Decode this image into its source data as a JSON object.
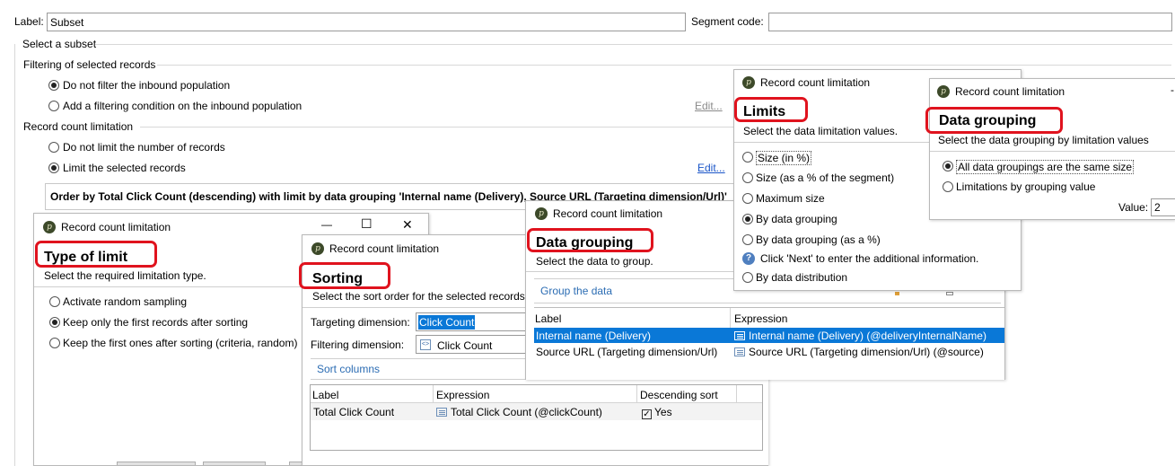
{
  "form": {
    "label_caption": "Label:",
    "label_value": "Subset",
    "segment_caption": "Segment code:",
    "segment_value": "",
    "select_subset": "Select a subset",
    "filtering_title": "Filtering of selected records",
    "filter_opt1": "Do not filter the inbound population",
    "filter_opt2": "Add a filtering condition on the inbound population",
    "edit_dim": "Edit...",
    "record_limit_title": "Record count limitation",
    "limit_opt1": "Do not limit the number of records",
    "limit_opt2": "Limit the selected records",
    "edit_link": "Edit...",
    "summary": "Order by Total Click Count (descending) with limit by data grouping 'Internal name (Delivery), Source URL (Targeting dimension/Url)'"
  },
  "dialog_type": {
    "title": "Record count limitation",
    "min_icon": "—",
    "max_icon": "☐",
    "close_icon": "✕",
    "heading": "Type of limit",
    "subtitle": "Select the required limitation type.",
    "opt1": "Activate random sampling",
    "opt2": "Keep only the first records after sorting",
    "opt3": "Keep the first ones after sorting (criteria, random)"
  },
  "dialog_sorting": {
    "title": "Record count limitation",
    "heading": "Sorting",
    "subtitle": "Select the sort order for the selected records",
    "targeting_caption": "Targeting dimension:",
    "targeting_value": "Click Count",
    "filtering_caption": "Filtering dimension:",
    "filtering_value": "Click Count",
    "section": "Sort columns",
    "columns": [
      "Label",
      "Expression",
      "Descending sort"
    ],
    "row": {
      "label": "Total Click Count",
      "expression": "Total Click Count (@clickCount)",
      "desc": "Yes",
      "check": "✓"
    }
  },
  "dialog_grouping": {
    "title": "Record count limitation",
    "heading": "Data grouping",
    "subtitle": "Select the data to group.",
    "section": "Group the data",
    "columns": [
      "Label",
      "Expression"
    ],
    "rows": [
      {
        "label": "Internal name (Delivery)",
        "expression": "Internal name (Delivery) (@deliveryInternalName)"
      },
      {
        "label": "Source URL (Targeting dimension/Url)",
        "expression": "Source URL (Targeting dimension/Url) (@source)"
      }
    ]
  },
  "dialog_limits": {
    "title": "Record count limitation",
    "heading": "Limits",
    "subtitle": "Select the data limitation values.",
    "opt1": "Size (in %)",
    "opt2": "Size (as a % of the segment)",
    "opt3": "Maximum size",
    "opt4": "By data grouping",
    "opt5": "By data grouping (as a %)",
    "info": "Click 'Next' to enter the additional information.",
    "opt6": "By data distribution"
  },
  "dialog_datagroup": {
    "title": "Record count limitation",
    "heading": "Data grouping",
    "subtitle": "Select the data grouping by limitation values",
    "opt1": "All data groupings are the same size",
    "opt2": "Limitations by grouping value",
    "value_caption": "Value:",
    "value": "2"
  },
  "colors": {
    "accent": "#e0131e",
    "link": "#1a55c8",
    "selection": "#0a78d7",
    "section_title": "#2b6cb3"
  }
}
